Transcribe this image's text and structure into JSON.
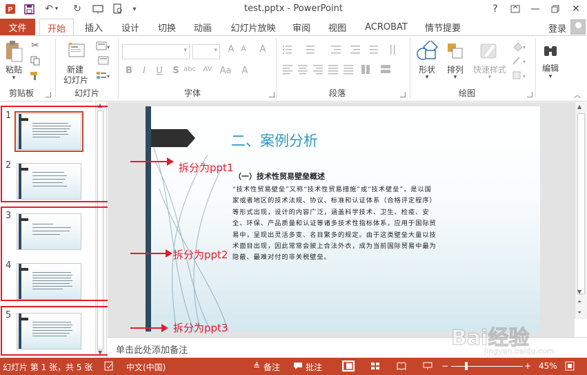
{
  "title_bar": {
    "title": "test.pptx - PowerPoint",
    "help": "?"
  },
  "tabs": {
    "file": "文件",
    "items": [
      "开始",
      "插入",
      "设计",
      "切换",
      "动画",
      "幻灯片放映",
      "审阅",
      "视图",
      "ACROBAT",
      "情节提要"
    ],
    "active": "开始",
    "login": "登录"
  },
  "ribbon": {
    "clipboard": {
      "paste": "粘贴",
      "label": "剪贴板"
    },
    "slides": {
      "new_slide_line1": "新建",
      "new_slide_line2": "幻灯片",
      "label": "幻灯片"
    },
    "font": {
      "label": "字体"
    },
    "paragraph": {
      "label": "段落"
    },
    "drawing": {
      "shape": "形状",
      "arrange": "排列",
      "quick_styles": "快速样式",
      "label": "绘图"
    },
    "editing": {
      "label": "编辑"
    }
  },
  "thumbnails": [
    {
      "number": "1",
      "selected": true
    },
    {
      "number": "2",
      "selected": false
    },
    {
      "number": "3",
      "selected": false
    },
    {
      "number": "4",
      "selected": false
    },
    {
      "number": "5",
      "selected": false
    }
  ],
  "slide": {
    "title": "二、案例分析",
    "subtitle": "（一）技术性贸易壁垒概述",
    "body": "“技术性贸易壁垒”又称“技术性贸易措施”或“技术壁垒”，是以国家或者地区的技术法规、协议、标准和认证体系（合格评定程序）等形式出现，设计的内容广泛，涵盖科学技术、卫生、检疫、安全、环保、产品质量和认证等诸多技术性指标体系，应用于国际贸易中，呈现出灵活多变、名目繁多的规定。由于这类壁垒大量以技术面目出现，因此常常会披上合法外衣，成为当前国际贸易中最为隐蔽、最难对付的非关税壁垒。"
  },
  "annotations": {
    "ppt1": "拆分为ppt1",
    "ppt2": "拆分为ppt2",
    "ppt3": "拆分为ppt3",
    "color": "#e8192c"
  },
  "notes": {
    "placeholder": "单击此处添加备注"
  },
  "status_bar": {
    "slide_info": "幻灯片 第 1 张，共 5 张",
    "language": "中文(中国)",
    "notes": "备注",
    "comments": "批注",
    "zoom": "45%"
  },
  "watermark": {
    "brand": "Bai经验",
    "url": "jingyan.baidu.com"
  },
  "colors": {
    "accent": "#c5452a",
    "slide_title": "#2f9ac2",
    "slide_bar": "#2e4a5f"
  }
}
